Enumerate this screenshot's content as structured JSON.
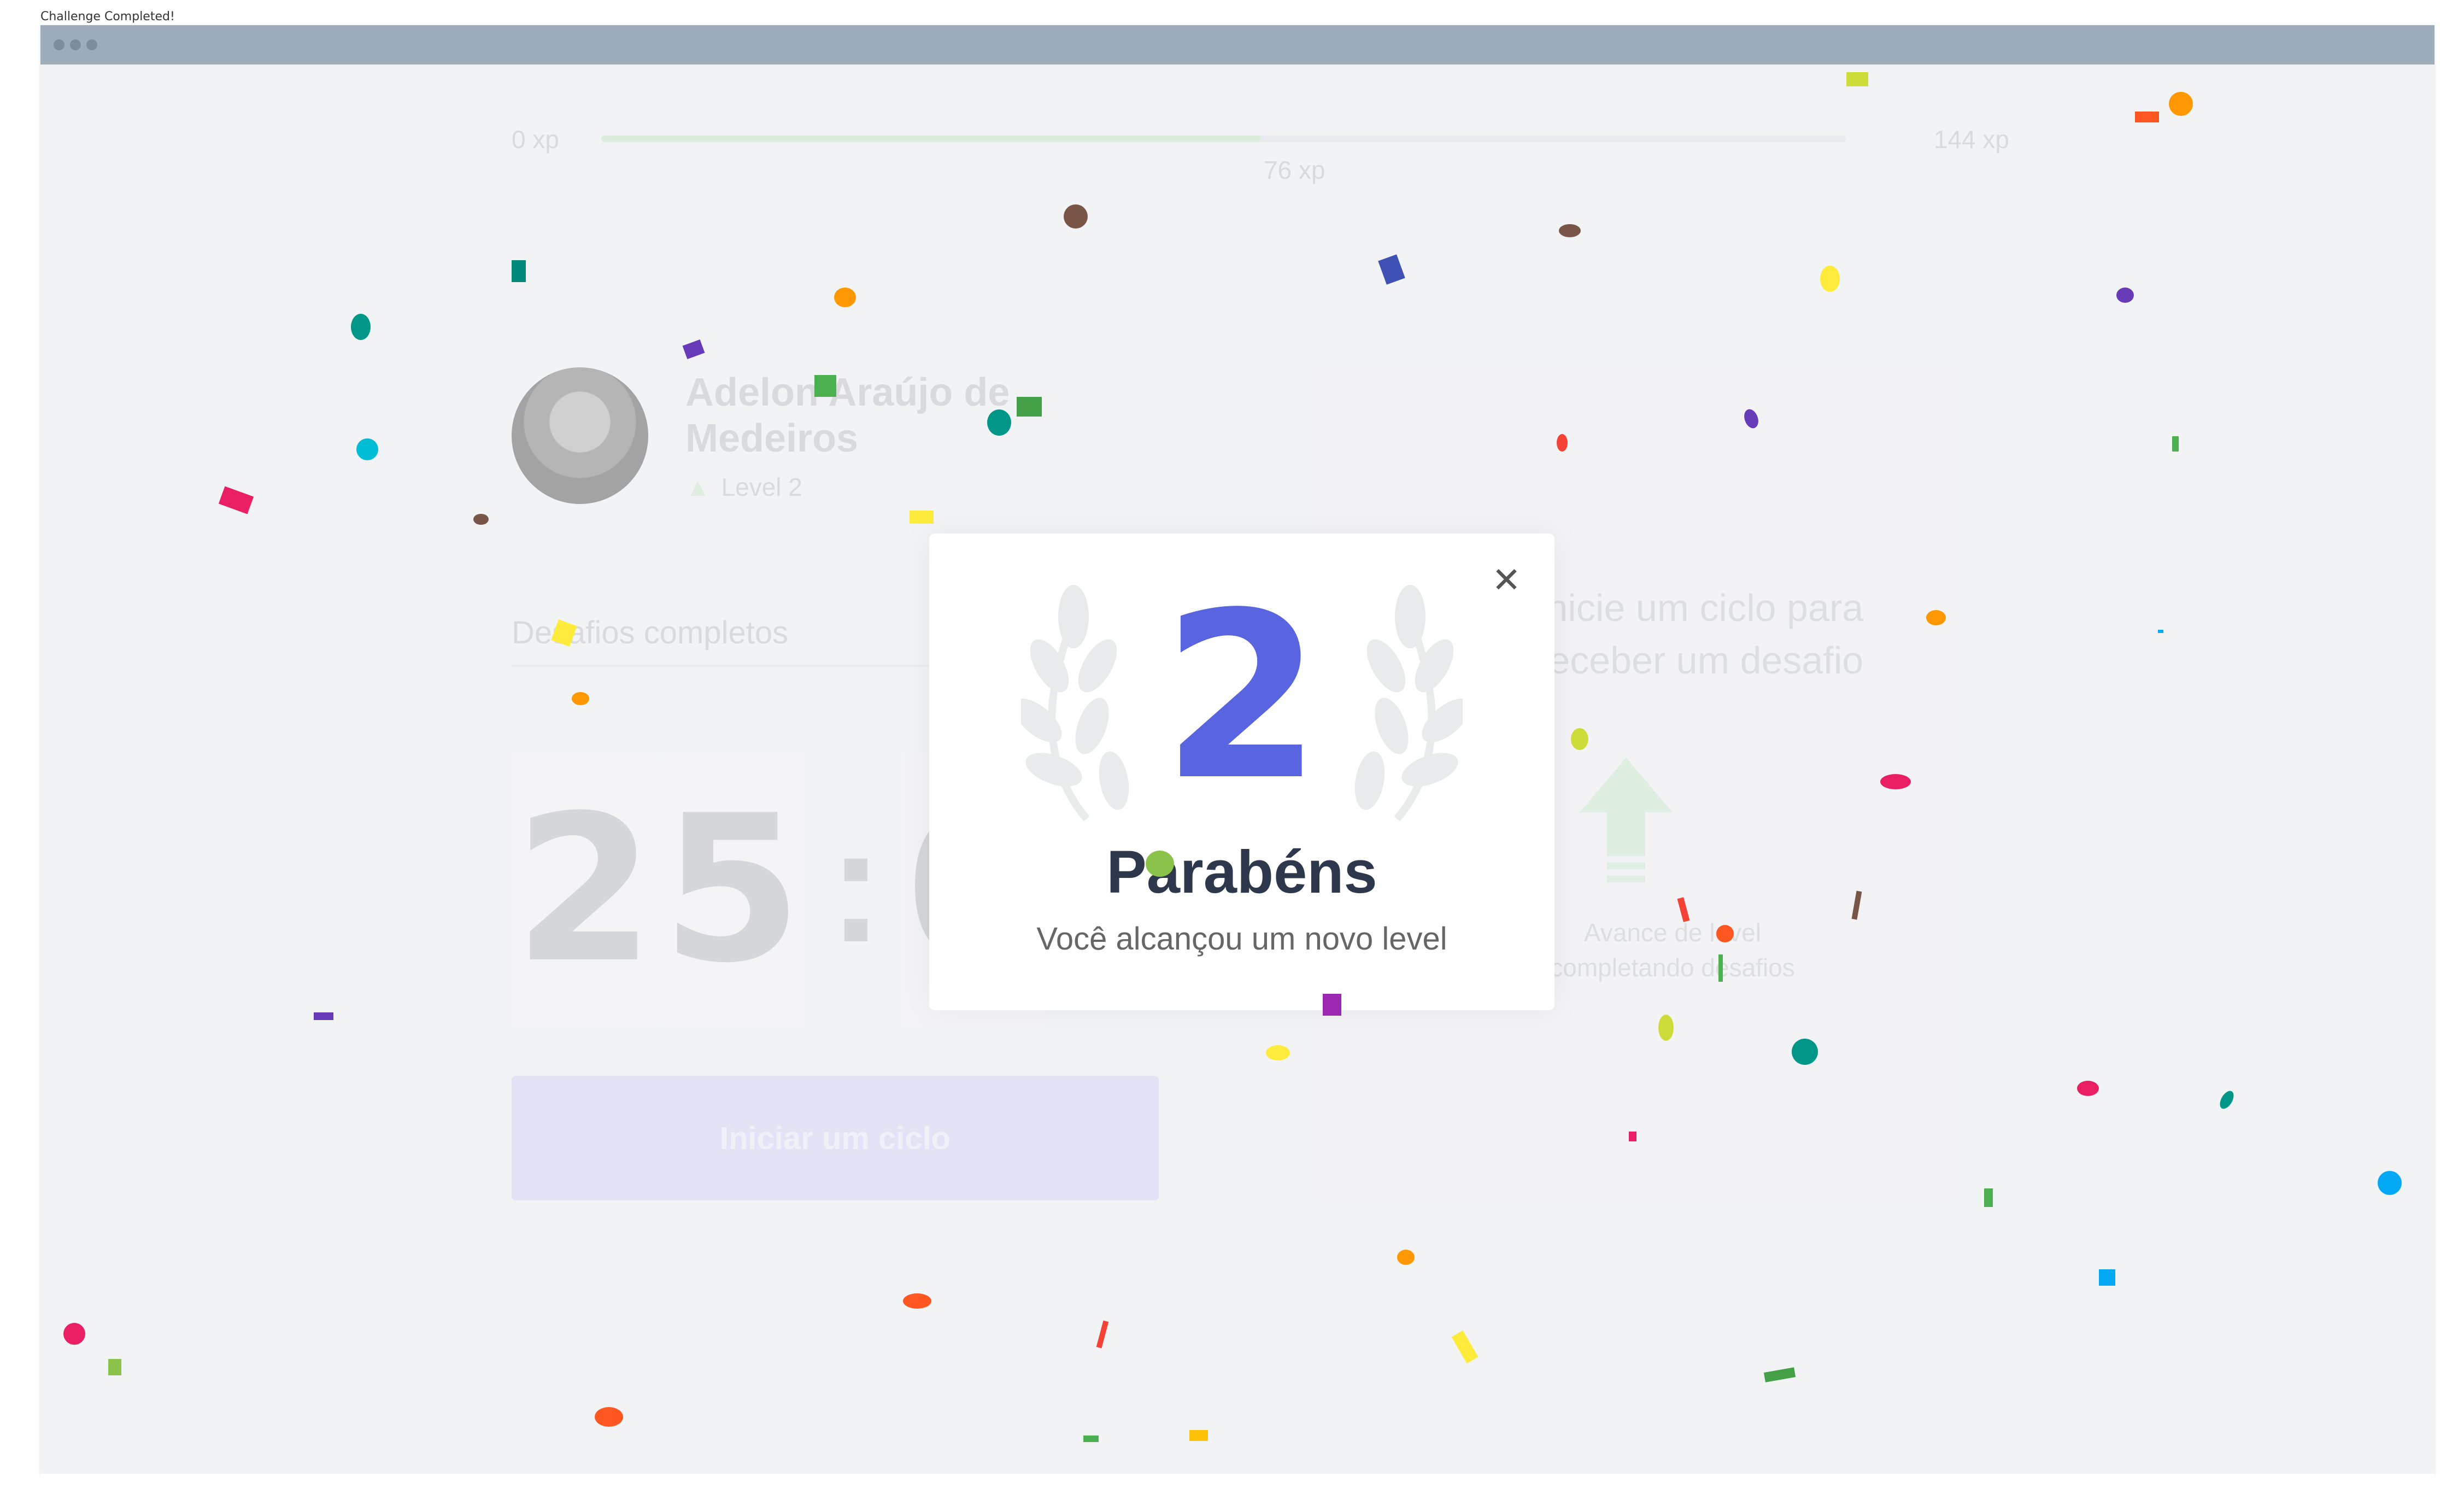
{
  "window": {
    "caption": "Challenge Completed!"
  },
  "xp": {
    "min_label": "0 xp",
    "max_label": "144 xp",
    "current_label": "76 xp",
    "progress_fraction": 0.53
  },
  "profile": {
    "name": "Adelon Araújo de Medeiros",
    "level_label": "Level 2"
  },
  "challenges": {
    "completed_label": "Desafios completos"
  },
  "countdown": {
    "digits": [
      "2",
      "5",
      "0"
    ],
    "separator": ":"
  },
  "actions": {
    "start_cycle_label": "Iniciar um ciclo"
  },
  "challenge_box": {
    "heading": "Inicie um ciclo para receber um desafio",
    "description": "Avance de level completando desafios"
  },
  "modal": {
    "level": "2",
    "title": "Parabéns",
    "subtitle": "Você alcançou um novo level",
    "close_icon": "close-icon"
  },
  "colors": {
    "accent": "#5965e0",
    "title_text": "#2e384d",
    "window_bar": "#9daeba",
    "app_background": "#f2f3f5",
    "xp_fill": "#4cd62b"
  }
}
